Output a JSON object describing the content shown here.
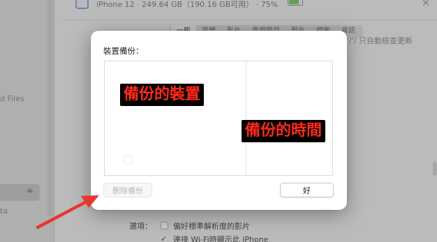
{
  "background": {
    "device_line": "iPhone 12 · 249.64 GB（190.16 GB可用） · 75%",
    "tabs": [
      {
        "label": "一般",
        "active": true
      },
      {
        "label": "音樂",
        "active": false
      },
      {
        "label": "影片",
        "active": false
      },
      {
        "label": "電視節目",
        "active": false
      },
      {
        "label": "照片",
        "active": false
      },
      {
        "label": "檔案",
        "active": false
      },
      {
        "label": "資訊",
        "active": false
      }
    ],
    "right_text": "'/'/ 只自動檢查更新",
    "sidebar": {
      "files_label": "d Files",
      "bottom_label": "ta"
    },
    "options": {
      "label": "選項：",
      "items": [
        {
          "text": "偏好標準解析度的影片",
          "checked": false
        },
        {
          "text": "連接 Wi-Fi時顯示此 iPhone",
          "checked": true
        }
      ]
    }
  },
  "dialog": {
    "title": "裝置備份：",
    "annotation_device": "備份的裝置",
    "annotation_time": "備份的時間",
    "delete_button": "刪除備份",
    "ok_button": "好"
  },
  "colors": {
    "annotation_text": "#ff2a1a",
    "annotation_bg": "#000000",
    "arrow": "#e8362f",
    "battery_fill": "#7ac26b"
  }
}
